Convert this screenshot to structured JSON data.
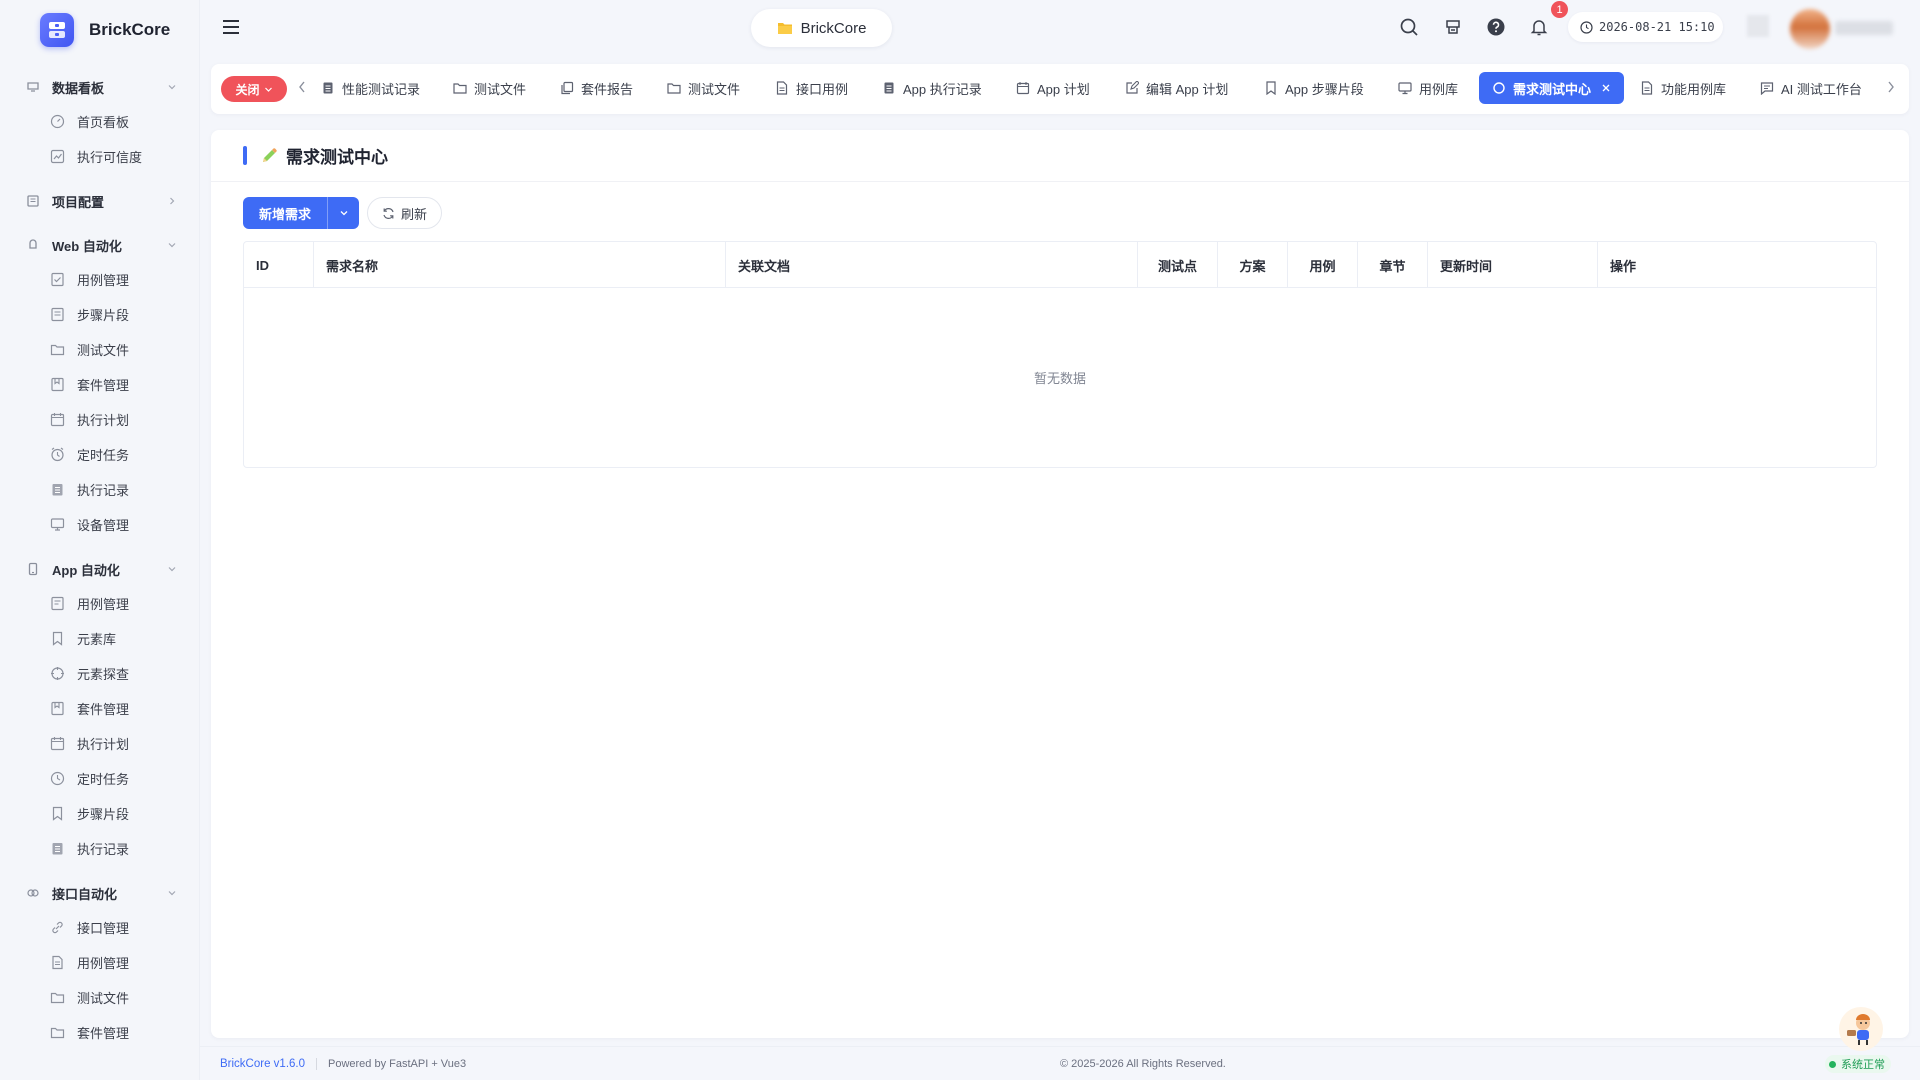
{
  "app": {
    "name": "BrickCore"
  },
  "sidebar": {
    "groups": [
      {
        "title": "数据看板",
        "icon": "dashboard-icon",
        "expanded": true,
        "items": [
          {
            "label": "首页看板",
            "icon": "gauge-icon"
          },
          {
            "label": "执行可信度",
            "icon": "chart-icon"
          }
        ]
      },
      {
        "title": "项目配置",
        "icon": "project-icon",
        "expanded": false,
        "items": []
      },
      {
        "title": "Web 自动化",
        "icon": "web-icon",
        "expanded": true,
        "items": [
          {
            "label": "用例管理",
            "icon": "case-icon"
          },
          {
            "label": "步骤片段",
            "icon": "steps-icon"
          },
          {
            "label": "测试文件",
            "icon": "folder-icon"
          },
          {
            "label": "套件管理",
            "icon": "suite-icon"
          },
          {
            "label": "执行计划",
            "icon": "calendar-icon"
          },
          {
            "label": "定时任务",
            "icon": "alarm-icon"
          },
          {
            "label": "执行记录",
            "icon": "record-icon"
          },
          {
            "label": "设备管理",
            "icon": "monitor-icon"
          }
        ]
      },
      {
        "title": "App 自动化",
        "icon": "mobile-icon",
        "expanded": true,
        "items": [
          {
            "label": "用例管理",
            "icon": "case-icon"
          },
          {
            "label": "元素库",
            "icon": "bookmark-icon"
          },
          {
            "label": "元素探查",
            "icon": "target-icon"
          },
          {
            "label": "套件管理",
            "icon": "suite-icon"
          },
          {
            "label": "执行计划",
            "icon": "calendar-icon"
          },
          {
            "label": "定时任务",
            "icon": "clock-icon"
          },
          {
            "label": "步骤片段",
            "icon": "bookmark-icon"
          },
          {
            "label": "执行记录",
            "icon": "record-icon"
          }
        ]
      },
      {
        "title": "接口自动化",
        "icon": "api-icon",
        "expanded": true,
        "items": [
          {
            "label": "接口管理",
            "icon": "link-icon"
          },
          {
            "label": "用例管理",
            "icon": "doc-icon"
          },
          {
            "label": "测试文件",
            "icon": "folder-icon"
          },
          {
            "label": "套件管理",
            "icon": "folder-icon"
          }
        ]
      }
    ]
  },
  "topbar": {
    "project": "BrickCore",
    "notification_count": "1",
    "datetime": "2026-08-21 15:10"
  },
  "tabs": {
    "close_label": "关闭",
    "items": [
      {
        "label": "性能测试记录",
        "icon": "record-icon"
      },
      {
        "label": "测试文件",
        "icon": "folder-icon"
      },
      {
        "label": "套件报告",
        "icon": "copy-icon"
      },
      {
        "label": "测试文件",
        "icon": "folder-icon"
      },
      {
        "label": "接口用例",
        "icon": "doc-icon"
      },
      {
        "label": "App 执行记录",
        "icon": "record-icon"
      },
      {
        "label": "App 计划",
        "icon": "calendar-icon"
      },
      {
        "label": "编辑 App 计划",
        "icon": "edit-icon"
      },
      {
        "label": "App 步骤片段",
        "icon": "bookmark-icon"
      },
      {
        "label": "用例库",
        "icon": "monitor-icon"
      },
      {
        "label": "需求测试中心",
        "icon": "circle-icon",
        "active": true
      },
      {
        "label": "功能用例库",
        "icon": "doc-icon"
      },
      {
        "label": "AI 测试工作台",
        "icon": "chat-icon"
      }
    ]
  },
  "page": {
    "title": "需求测试中心",
    "new_button": "新增需求",
    "refresh_button": "刷新",
    "table": {
      "columns": [
        "ID",
        "需求名称",
        "关联文档",
        "测试点",
        "方案",
        "用例",
        "章节",
        "更新时间",
        "操作"
      ],
      "rows": [],
      "empty_text": "暂无数据"
    }
  },
  "footer": {
    "version": "BrickCore v1.6.0",
    "powered": "Powered by FastAPI + Vue3",
    "copyright": "© 2025-2026 All Rights Reserved.",
    "status": "系统正常"
  },
  "colors": {
    "primary": "#3e6bf5",
    "danger": "#f0535a",
    "success": "#23b35c"
  }
}
